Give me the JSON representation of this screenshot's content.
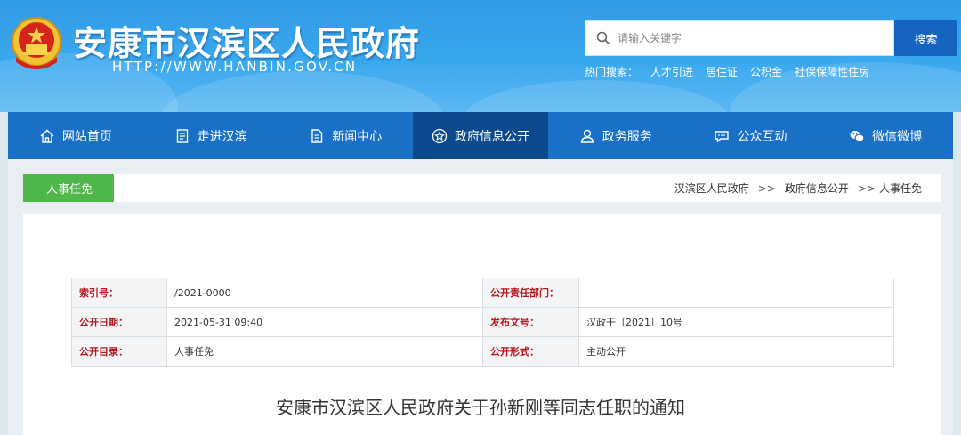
{
  "header": {
    "site_title": "安康市汉滨区人民政府",
    "site_url": "HTTP://WWW.HANBIN.GOV.CN",
    "search": {
      "placeholder": "请输入关键字",
      "button_label": "搜索"
    },
    "hot_search": {
      "label": "热门搜索：",
      "items": [
        "人才引进",
        "居住证",
        "公积金",
        "社保保障性住房"
      ]
    }
  },
  "nav": {
    "items": [
      {
        "label": "网站首页",
        "icon": "home-icon"
      },
      {
        "label": "走进汉滨",
        "icon": "document-icon"
      },
      {
        "label": "新闻中心",
        "icon": "news-icon"
      },
      {
        "label": "政府信息公开",
        "icon": "star-icon",
        "active": true
      },
      {
        "label": "政务服务",
        "icon": "user-icon"
      },
      {
        "label": "公众互动",
        "icon": "chat-icon"
      },
      {
        "label": "微信微博",
        "icon": "wechat-icon"
      }
    ]
  },
  "section": {
    "tag": "人事任免",
    "breadcrumb": [
      "汉滨区人民政府",
      "政府信息公开",
      "人事任免"
    ],
    "separator": ">>"
  },
  "meta": {
    "rows": [
      {
        "k1": "索引号：",
        "v1": "/2021-0000",
        "k2": "公开责任部门：",
        "v2": ""
      },
      {
        "k1": "公开日期：",
        "v1": "2021-05-31 09:40",
        "k2": "发布文号：",
        "v2": "汉政干〔2021〕10号"
      },
      {
        "k1": "公开目录：",
        "v1": "人事任免",
        "k2": "公开形式：",
        "v2": "主动公开"
      }
    ]
  },
  "document": {
    "title": "安康市汉滨区人民政府关于孙新刚等同志任职的通知"
  },
  "colors": {
    "nav_bg": "#1a6fc7",
    "nav_active": "#0d4a8d",
    "tag_green": "#4eb84a",
    "label_red": "#b3191f",
    "search_btn": "#1565c0"
  }
}
